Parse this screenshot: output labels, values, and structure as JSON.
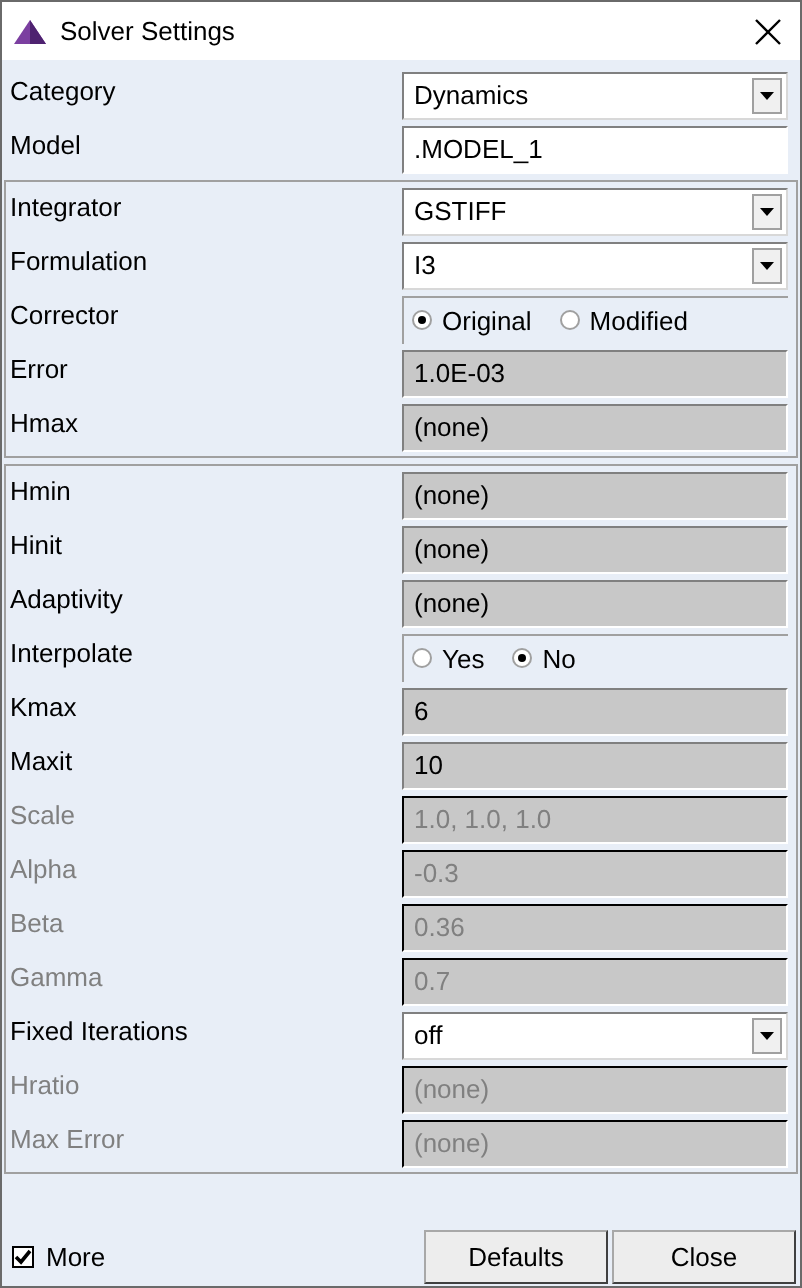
{
  "window": {
    "title": "Solver Settings"
  },
  "sections": [
    {
      "framed": false,
      "rows": [
        {
          "label": "Category",
          "kind": "dropdown",
          "value": "Dynamics",
          "disabled": false
        },
        {
          "label": "Model",
          "kind": "text",
          "value": ".MODEL_1",
          "disabled": false
        }
      ]
    },
    {
      "framed": true,
      "rows": [
        {
          "label": "Integrator",
          "kind": "dropdown",
          "value": "GSTIFF",
          "disabled": false
        },
        {
          "label": "Formulation",
          "kind": "dropdown",
          "value": "I3",
          "disabled": false
        },
        {
          "label": "Corrector",
          "kind": "radio",
          "options": [
            {
              "label": "Original",
              "selected": true
            },
            {
              "label": "Modified",
              "selected": false
            }
          ],
          "disabled": false
        },
        {
          "label": "Error",
          "kind": "readonly",
          "value": "1.0E-03",
          "disabled": false
        },
        {
          "label": "Hmax",
          "kind": "readonly",
          "value": "(none)",
          "disabled": false
        }
      ]
    },
    {
      "framed": true,
      "rows": [
        {
          "label": "Hmin",
          "kind": "readonly",
          "value": "(none)",
          "disabled": false
        },
        {
          "label": "Hinit",
          "kind": "readonly",
          "value": "(none)",
          "disabled": false
        },
        {
          "label": "Adaptivity",
          "kind": "readonly",
          "value": "(none)",
          "disabled": false
        },
        {
          "label": "Interpolate",
          "kind": "radio",
          "options": [
            {
              "label": "Yes",
              "selected": false
            },
            {
              "label": "No",
              "selected": true
            }
          ],
          "disabled": false
        },
        {
          "label": "Kmax",
          "kind": "readonly",
          "value": "6",
          "disabled": false
        },
        {
          "label": "Maxit",
          "kind": "readonly",
          "value": "10",
          "disabled": false
        },
        {
          "label": "Scale",
          "kind": "readonly",
          "value": "1.0, 1.0, 1.0",
          "disabled": true
        },
        {
          "label": "Alpha",
          "kind": "readonly",
          "value": "-0.3",
          "disabled": true
        },
        {
          "label": "Beta",
          "kind": "readonly",
          "value": "0.36",
          "disabled": true
        },
        {
          "label": "Gamma",
          "kind": "readonly",
          "value": "0.7",
          "disabled": true
        },
        {
          "label": "Fixed Iterations",
          "kind": "dropdown",
          "value": "off",
          "disabled": false
        },
        {
          "label": "Hratio",
          "kind": "readonly",
          "value": "(none)",
          "disabled": true
        },
        {
          "label": "Max Error",
          "kind": "readonly",
          "value": "(none)",
          "disabled": true
        }
      ]
    }
  ],
  "more": {
    "label": "More",
    "checked": true
  },
  "buttons": [
    "Defaults",
    "Close"
  ]
}
